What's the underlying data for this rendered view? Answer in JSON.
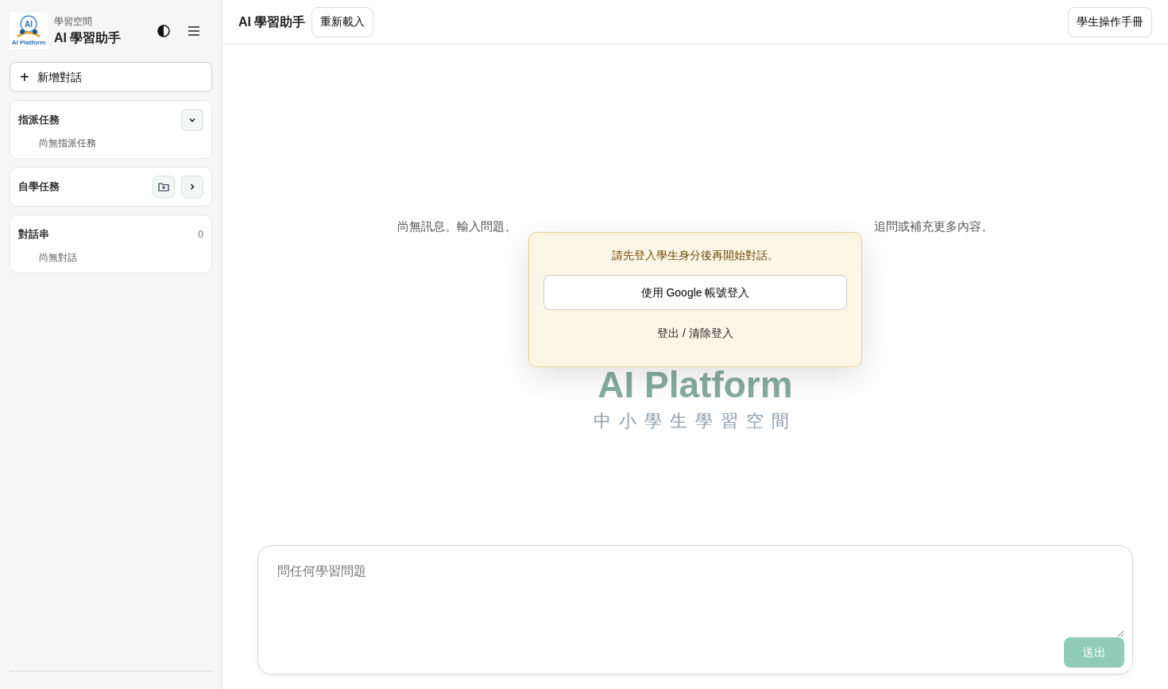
{
  "sidebar": {
    "logo_mark": "AI",
    "logo_text": "AI Platform",
    "eyebrow": "學習空間",
    "title": "AI 學習助手",
    "new_chat": {
      "label": "新增對話",
      "icon": "+"
    },
    "sections": [
      {
        "kind": "assigned",
        "title": "指派任務",
        "expanded": true,
        "empty_text": "尚無指派任務"
      },
      {
        "kind": "self_study",
        "title": "自學任務",
        "expanded": false
      },
      {
        "kind": "threads",
        "title": "對話串",
        "count": "0",
        "empty_text": "尚無對話"
      }
    ]
  },
  "header": {
    "title": "AI 學習助手",
    "reload_button": "重新載入",
    "manual_button": "學生操作手冊"
  },
  "empty_state": {
    "text_start": "尚無訊息。輸入問題、",
    "text_end": "追問或補充更多內容。",
    "watermark_title": "AI Platform",
    "watermark_subtitle": "中小學生學習空間"
  },
  "login_popup": {
    "message": "請先登入學生身分後再開始對話。",
    "google_button": "使用 Google 帳號登入",
    "logout_link": "登出 / 清除登入"
  },
  "composer": {
    "placeholder": "問任何學習問題",
    "send_button": "送出",
    "send_disabled": true
  }
}
